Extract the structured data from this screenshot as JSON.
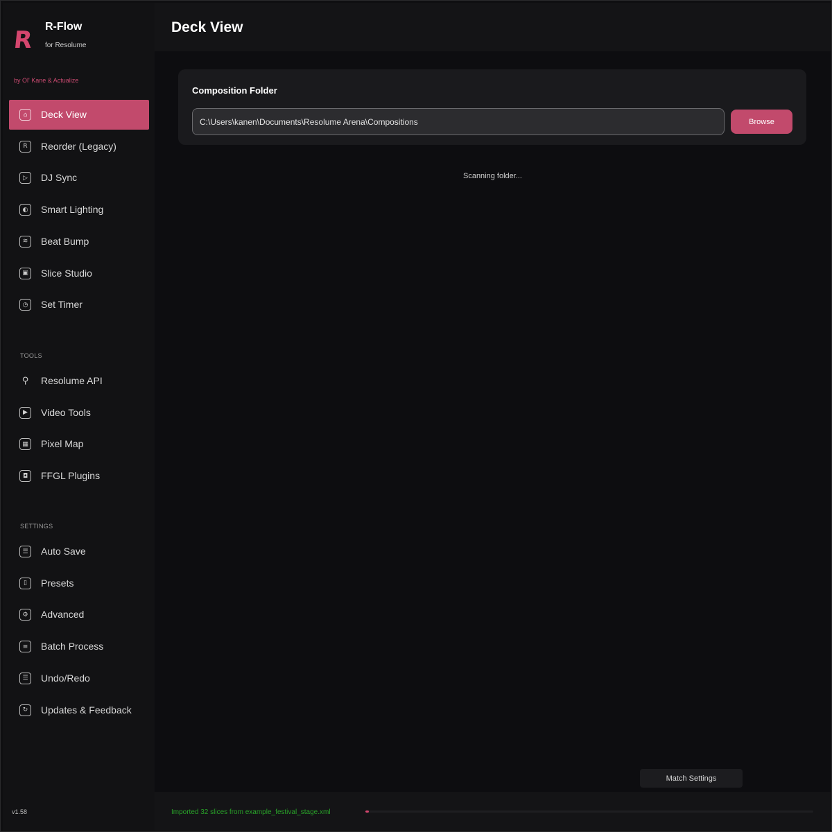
{
  "brand": {
    "logo_letter": "R",
    "title": "R-Flow",
    "subtitle": "for Resolume",
    "by_line": "by Ol' Kane & Actualize"
  },
  "nav": {
    "main_items": [
      {
        "label": "Deck View",
        "icon": "home-icon",
        "glyph": "⌂",
        "active": true
      },
      {
        "label": "Reorder (Legacy)",
        "icon": "resolume-logo-icon",
        "glyph": "R"
      },
      {
        "label": "DJ Sync",
        "icon": "play-icon",
        "glyph": "▷"
      },
      {
        "label": "Smart Lighting",
        "icon": "lighting-icon",
        "glyph": "◐"
      },
      {
        "label": "Beat Bump",
        "icon": "waveform-icon",
        "glyph": "≋"
      },
      {
        "label": "Slice Studio",
        "icon": "image-icon",
        "glyph": "▣"
      },
      {
        "label": "Set Timer",
        "icon": "clock-icon",
        "glyph": "◷"
      }
    ],
    "tools_label": "TOOLS",
    "tools_items": [
      {
        "label": "Resolume API",
        "icon": "plug-icon",
        "glyph": "⚲"
      },
      {
        "label": "Video Tools",
        "icon": "video-icon",
        "glyph": "▶"
      },
      {
        "label": "Pixel Map",
        "icon": "pixel-map-icon",
        "glyph": "▦"
      },
      {
        "label": "FFGL Plugins",
        "icon": "gamepad-icon",
        "glyph": "◘"
      }
    ],
    "settings_label": "SETTINGS",
    "settings_items": [
      {
        "label": "Auto Save",
        "icon": "list-icon",
        "glyph": "☰"
      },
      {
        "label": "Presets",
        "icon": "bookmark-icon",
        "glyph": "▯"
      },
      {
        "label": "Advanced",
        "icon": "gear-icon",
        "glyph": "⚙"
      },
      {
        "label": "Batch Process",
        "icon": "document-icon",
        "glyph": "≡"
      },
      {
        "label": "Undo/Redo",
        "icon": "history-list-icon",
        "glyph": "☰"
      },
      {
        "label": "Updates & Feedback",
        "icon": "refresh-icon",
        "glyph": "↻"
      }
    ],
    "version": "v1.58"
  },
  "header": {
    "title": "Deck View"
  },
  "composition": {
    "title": "Composition Folder",
    "path_value": "C:\\Users\\kanen\\Documents\\Resolume Arena\\Compositions",
    "browse_label": "Browse"
  },
  "status": {
    "scanning_text": "Scanning folder..."
  },
  "match_settings_label": "Match Settings",
  "footer": {
    "message": "Imported 32 slices from example_festival_stage.xml",
    "progress_fraction": 0.008
  },
  "colors": {
    "accent": "#c24a6c",
    "success": "#29a329"
  }
}
